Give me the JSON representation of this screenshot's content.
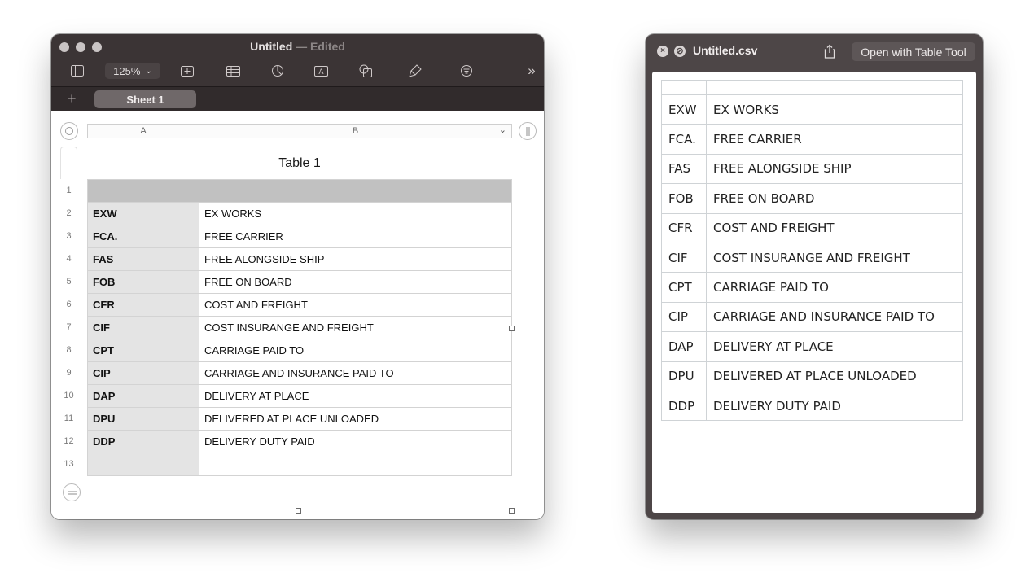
{
  "numbers": {
    "title": "Untitled",
    "title_sep": " — ",
    "edited": "Edited",
    "zoom": "125%",
    "sheet_tab": "Sheet 1",
    "plus": "+",
    "overflow": "»",
    "col_headers": [
      "A",
      "B"
    ],
    "table_title": "Table 1",
    "row_numbers": [
      "1",
      "2",
      "3",
      "4",
      "5",
      "6",
      "7",
      "8",
      "9",
      "10",
      "11",
      "12",
      "13"
    ],
    "rows": [
      [
        "",
        ""
      ],
      [
        "EXW",
        "EX WORKS"
      ],
      [
        "FCA.",
        "FREE CARRIER"
      ],
      [
        "FAS",
        "FREE ALONGSIDE SHIP"
      ],
      [
        "FOB",
        "FREE ON BOARD"
      ],
      [
        "CFR",
        "COST AND FREIGHT"
      ],
      [
        "CIF",
        "COST INSURANGE AND FREIGHT"
      ],
      [
        "CPT",
        "CARRIAGE PAID TO"
      ],
      [
        "CIP",
        "CARRIAGE AND INSURANCE PAID TO"
      ],
      [
        "DAP",
        "DELIVERY AT PLACE"
      ],
      [
        "DPU",
        "DELIVERED AT PLACE UNLOADED"
      ],
      [
        "DDP",
        "DELIVERY DUTY PAID"
      ],
      [
        "",
        ""
      ]
    ]
  },
  "csv": {
    "title": "Untitled.csv",
    "close_glyph": "×",
    "minimize_glyph": "⊘",
    "open_button": "Open with Table Tool",
    "rows": [
      [
        "",
        ""
      ],
      [
        "EXW",
        "EX WORKS"
      ],
      [
        "FCA.",
        "FREE CARRIER"
      ],
      [
        "FAS",
        "FREE ALONGSIDE SHIP"
      ],
      [
        "FOB",
        "FREE ON BOARD"
      ],
      [
        "CFR",
        "COST AND FREIGHT"
      ],
      [
        "CIF",
        "COST INSURANGE AND FREIGHT"
      ],
      [
        "CPT",
        "CARRIAGE PAID TO"
      ],
      [
        "CIP",
        "CARRIAGE AND INSURANCE PAID TO"
      ],
      [
        "DAP",
        "DELIVERY AT PLACE"
      ],
      [
        "DPU",
        "DELIVERED AT PLACE UNLOADED"
      ],
      [
        "DDP",
        "DELIVERY DUTY PAID"
      ]
    ]
  },
  "colors": {
    "toolbar_bg": "#3b3435",
    "header_row": "#c1c1c1",
    "col_a_fill": "#e4e4e4",
    "csv_frame": "#4d4647"
  }
}
